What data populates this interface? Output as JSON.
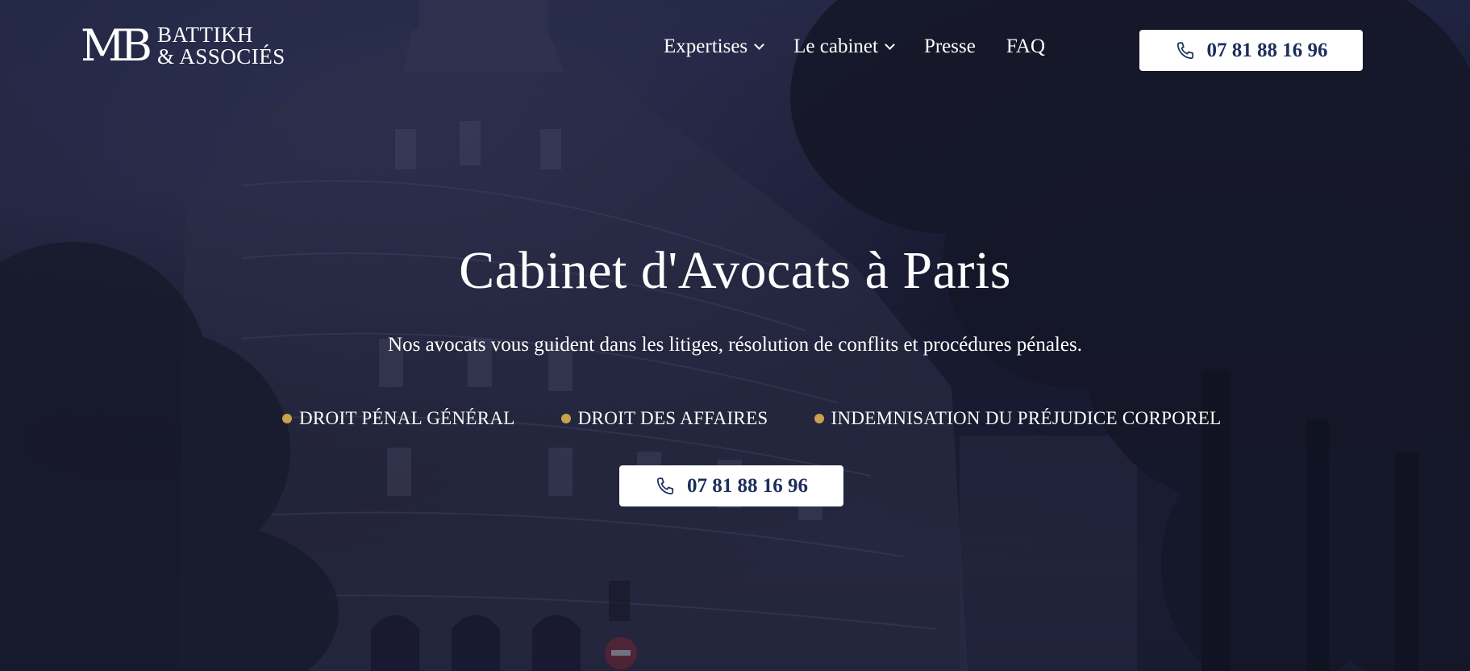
{
  "brand": {
    "mark": "MB",
    "line1": "BATTIKH",
    "line2": "& ASSOCIÉS"
  },
  "nav": {
    "items": [
      {
        "label": "Expertises",
        "has_dropdown": true
      },
      {
        "label": "Le cabinet",
        "has_dropdown": true
      },
      {
        "label": "Presse",
        "has_dropdown": false
      },
      {
        "label": "FAQ",
        "has_dropdown": false
      }
    ]
  },
  "header_phone": {
    "label": "07 81 88 16 96",
    "icon": "phone-icon"
  },
  "hero": {
    "title": "Cabinet d'Avocats à Paris",
    "subtitle": "Nos avocats vous guident dans les litiges, résolution de conflits et procédures pénales.",
    "tags": [
      "DROIT PÉNAL GÉNÉRAL",
      "DROIT DES AFFAIRES",
      "INDEMNISATION DU PRÉJUDICE CORPOREL"
    ],
    "cta_phone": "07 81 88 16 96"
  },
  "colors": {
    "accent": "#c9a24d",
    "button_text": "#1c2e5c",
    "overlay": "#1e2340"
  }
}
